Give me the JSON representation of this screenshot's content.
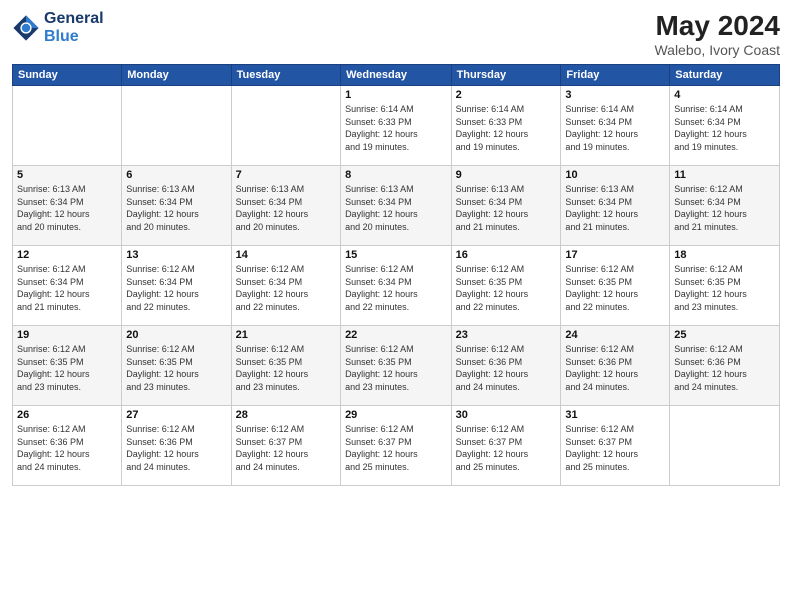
{
  "header": {
    "logo_line1": "General",
    "logo_line2": "Blue",
    "month_year": "May 2024",
    "location": "Walebo, Ivory Coast"
  },
  "weekdays": [
    "Sunday",
    "Monday",
    "Tuesday",
    "Wednesday",
    "Thursday",
    "Friday",
    "Saturday"
  ],
  "weeks": [
    [
      {
        "day": "",
        "info": ""
      },
      {
        "day": "",
        "info": ""
      },
      {
        "day": "",
        "info": ""
      },
      {
        "day": "1",
        "info": "Sunrise: 6:14 AM\nSunset: 6:33 PM\nDaylight: 12 hours\nand 19 minutes."
      },
      {
        "day": "2",
        "info": "Sunrise: 6:14 AM\nSunset: 6:33 PM\nDaylight: 12 hours\nand 19 minutes."
      },
      {
        "day": "3",
        "info": "Sunrise: 6:14 AM\nSunset: 6:34 PM\nDaylight: 12 hours\nand 19 minutes."
      },
      {
        "day": "4",
        "info": "Sunrise: 6:14 AM\nSunset: 6:34 PM\nDaylight: 12 hours\nand 19 minutes."
      }
    ],
    [
      {
        "day": "5",
        "info": "Sunrise: 6:13 AM\nSunset: 6:34 PM\nDaylight: 12 hours\nand 20 minutes."
      },
      {
        "day": "6",
        "info": "Sunrise: 6:13 AM\nSunset: 6:34 PM\nDaylight: 12 hours\nand 20 minutes."
      },
      {
        "day": "7",
        "info": "Sunrise: 6:13 AM\nSunset: 6:34 PM\nDaylight: 12 hours\nand 20 minutes."
      },
      {
        "day": "8",
        "info": "Sunrise: 6:13 AM\nSunset: 6:34 PM\nDaylight: 12 hours\nand 20 minutes."
      },
      {
        "day": "9",
        "info": "Sunrise: 6:13 AM\nSunset: 6:34 PM\nDaylight: 12 hours\nand 21 minutes."
      },
      {
        "day": "10",
        "info": "Sunrise: 6:13 AM\nSunset: 6:34 PM\nDaylight: 12 hours\nand 21 minutes."
      },
      {
        "day": "11",
        "info": "Sunrise: 6:12 AM\nSunset: 6:34 PM\nDaylight: 12 hours\nand 21 minutes."
      }
    ],
    [
      {
        "day": "12",
        "info": "Sunrise: 6:12 AM\nSunset: 6:34 PM\nDaylight: 12 hours\nand 21 minutes."
      },
      {
        "day": "13",
        "info": "Sunrise: 6:12 AM\nSunset: 6:34 PM\nDaylight: 12 hours\nand 22 minutes."
      },
      {
        "day": "14",
        "info": "Sunrise: 6:12 AM\nSunset: 6:34 PM\nDaylight: 12 hours\nand 22 minutes."
      },
      {
        "day": "15",
        "info": "Sunrise: 6:12 AM\nSunset: 6:34 PM\nDaylight: 12 hours\nand 22 minutes."
      },
      {
        "day": "16",
        "info": "Sunrise: 6:12 AM\nSunset: 6:35 PM\nDaylight: 12 hours\nand 22 minutes."
      },
      {
        "day": "17",
        "info": "Sunrise: 6:12 AM\nSunset: 6:35 PM\nDaylight: 12 hours\nand 22 minutes."
      },
      {
        "day": "18",
        "info": "Sunrise: 6:12 AM\nSunset: 6:35 PM\nDaylight: 12 hours\nand 23 minutes."
      }
    ],
    [
      {
        "day": "19",
        "info": "Sunrise: 6:12 AM\nSunset: 6:35 PM\nDaylight: 12 hours\nand 23 minutes."
      },
      {
        "day": "20",
        "info": "Sunrise: 6:12 AM\nSunset: 6:35 PM\nDaylight: 12 hours\nand 23 minutes."
      },
      {
        "day": "21",
        "info": "Sunrise: 6:12 AM\nSunset: 6:35 PM\nDaylight: 12 hours\nand 23 minutes."
      },
      {
        "day": "22",
        "info": "Sunrise: 6:12 AM\nSunset: 6:35 PM\nDaylight: 12 hours\nand 23 minutes."
      },
      {
        "day": "23",
        "info": "Sunrise: 6:12 AM\nSunset: 6:36 PM\nDaylight: 12 hours\nand 24 minutes."
      },
      {
        "day": "24",
        "info": "Sunrise: 6:12 AM\nSunset: 6:36 PM\nDaylight: 12 hours\nand 24 minutes."
      },
      {
        "day": "25",
        "info": "Sunrise: 6:12 AM\nSunset: 6:36 PM\nDaylight: 12 hours\nand 24 minutes."
      }
    ],
    [
      {
        "day": "26",
        "info": "Sunrise: 6:12 AM\nSunset: 6:36 PM\nDaylight: 12 hours\nand 24 minutes."
      },
      {
        "day": "27",
        "info": "Sunrise: 6:12 AM\nSunset: 6:36 PM\nDaylight: 12 hours\nand 24 minutes."
      },
      {
        "day": "28",
        "info": "Sunrise: 6:12 AM\nSunset: 6:37 PM\nDaylight: 12 hours\nand 24 minutes."
      },
      {
        "day": "29",
        "info": "Sunrise: 6:12 AM\nSunset: 6:37 PM\nDaylight: 12 hours\nand 25 minutes."
      },
      {
        "day": "30",
        "info": "Sunrise: 6:12 AM\nSunset: 6:37 PM\nDaylight: 12 hours\nand 25 minutes."
      },
      {
        "day": "31",
        "info": "Sunrise: 6:12 AM\nSunset: 6:37 PM\nDaylight: 12 hours\nand 25 minutes."
      },
      {
        "day": "",
        "info": ""
      }
    ]
  ]
}
